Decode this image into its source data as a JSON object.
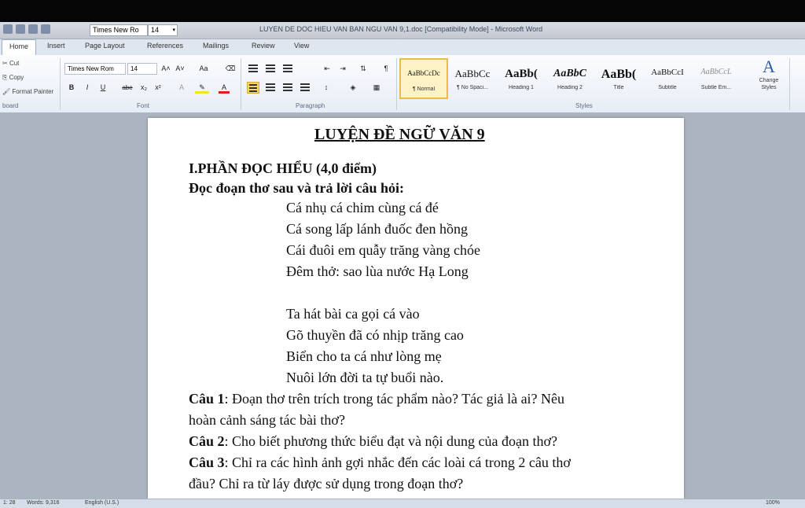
{
  "title_bar": {
    "font_name": "Times New Ro",
    "font_size": "14",
    "window_title": "LUYEN DE DOC HIEU VAN BAN NGU VAN 9,1.doc [Compatibility Mode] - Microsoft Word"
  },
  "tabs": [
    "Home",
    "Insert",
    "Page Layout",
    "References",
    "Mailings",
    "Review",
    "View"
  ],
  "clipboard": {
    "cut": "Cut",
    "copy": "Copy",
    "format_painter": "Format Painter",
    "label": "board"
  },
  "font_group": {
    "font_name": "Times New Rom",
    "font_size": "14",
    "grow": "A˄",
    "shrink": "A˅",
    "change_case": "Aa",
    "bold": "B",
    "italic": "I",
    "underline": "U",
    "strike": "abe",
    "subscript": "x₂",
    "superscript": "x²",
    "label": "Font"
  },
  "paragraph_group": {
    "label": "Paragraph"
  },
  "styles_group": {
    "label": "Styles",
    "items": [
      {
        "sample": "AaBbCcDc",
        "name": "¶ Normal"
      },
      {
        "sample": "AaBbCc",
        "name": "¶ No Spaci..."
      },
      {
        "sample": "AaBb(",
        "name": "Heading 1"
      },
      {
        "sample": "AaBbC",
        "name": "Heading 2"
      },
      {
        "sample": "AaBb(",
        "name": "Title"
      },
      {
        "sample": "AaBbCcI",
        "name": "Subtitle"
      },
      {
        "sample": "AaBbCcL",
        "name": "Subtle Em..."
      }
    ],
    "change_styles": "Change Styles"
  },
  "document": {
    "title": "LUYỆN ĐỀ NGỮ VĂN 9",
    "section": "I.PHẦN ĐỌC HIỂU (4,0 điểm)",
    "instruction": "Đọc đoạn thơ sau và trả lời câu hỏi:",
    "poem_stanza1": [
      "Cá nhụ cá chim cùng cá đé",
      "Cá song lấp lánh đuốc đen hồng",
      "Cái đuôi em quẫy trăng vàng chóe",
      "Đêm thở: sao lùa nước Hạ Long"
    ],
    "poem_stanza2": [
      "Ta hát bài ca gọi cá vào",
      "Gõ thuyền đã có nhịp trăng cao",
      "Biển cho ta cá như lòng mẹ",
      "Nuôi lớn đời ta tự buổi nào."
    ],
    "questions": [
      {
        "label": "Câu 1",
        "lines": [
          ": Đoạn thơ trên trích trong tác phẩm nào? Tác giả là ai? Nêu",
          "hoàn cảnh sáng tác bài thơ?"
        ]
      },
      {
        "label": "Câu 2",
        "lines": [
          ": Cho biết phương thức biểu đạt và nội dung của đoạn thơ?"
        ]
      },
      {
        "label": "Câu 3",
        "lines": [
          ": Chỉ ra các hình ảnh gợi nhắc đến các loài cá trong 2 câu thơ",
          "đầu? Chỉ ra từ láy được sử dụng trong đoạn thơ?"
        ]
      }
    ]
  },
  "status_bar": {
    "page": "1: 28",
    "words": "Words: 9,316",
    "language": "English (U.S.)",
    "zoom": "100%"
  }
}
